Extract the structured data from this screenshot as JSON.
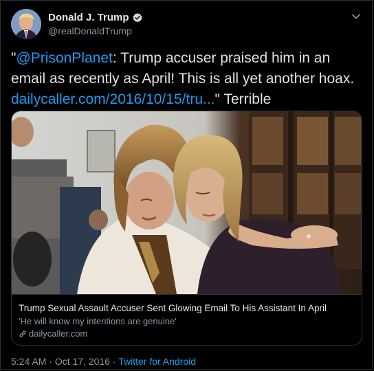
{
  "user": {
    "display_name": "Donald J. Trump",
    "handle": "@realDonaldTrump",
    "verified": true
  },
  "tweet": {
    "quote_open": "\"",
    "mention": "@PrisonPlanet",
    "body": ": Trump accuser praised him in an email as recently as April! This is all yet another hoax. ",
    "link_text": "dailycaller.com/2016/10/15/tru...",
    "quote_close": "\"",
    "trailing": " Terrible"
  },
  "card": {
    "title": "Trump Sexual Assault Accuser Sent Glowing Email To His Assistant In April",
    "description": "'He will know my intentions are genuine'",
    "domain": "dailycaller.com"
  },
  "meta": {
    "time": "5:24 AM",
    "separator1": " · ",
    "date": "Oct 17, 2016",
    "separator2": " · ",
    "source": "Twitter for Android"
  },
  "colors": {
    "background": "#000000",
    "link": "#1d9bf0",
    "secondary_text": "#8b98a5",
    "border": "#2f3336"
  }
}
